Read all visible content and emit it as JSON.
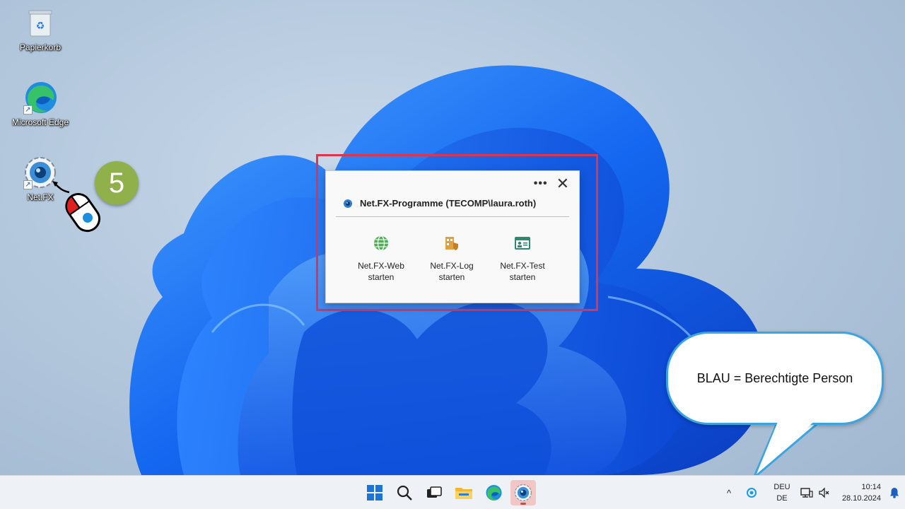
{
  "desktop": {
    "icons": [
      {
        "label": "Papierkorb"
      },
      {
        "label": "Microsoft Edge"
      },
      {
        "label": "Net.FX"
      }
    ],
    "step_number": "5"
  },
  "popup": {
    "title": "Net.FX-Programme (TECOMP\\laura.roth)",
    "more_label": "•••",
    "close_label": "✕",
    "actions": [
      {
        "line1": "Net.FX-Web",
        "line2": "starten",
        "icon": "globe-icon",
        "color": "#4caf50"
      },
      {
        "line1": "Net.FX-Log",
        "line2": "starten",
        "icon": "building-shield-icon",
        "color": "#e0a040"
      },
      {
        "line1": "Net.FX-Test",
        "line2": "starten",
        "icon": "id-card-icon",
        "color": "#2e8a6e"
      }
    ],
    "highlight_color": "#e0344a"
  },
  "callout": {
    "text": "BLAU = Berechtigte Person",
    "border_color": "#3aa5e0"
  },
  "taskbar": {
    "apps": [
      "start-icon",
      "search-icon",
      "task-view-icon",
      "file-explorer-icon",
      "edge-icon",
      "netfx-icon"
    ],
    "tray": {
      "chevron": "^",
      "lang_line1": "DEU",
      "lang_line2": "DE",
      "time": "10:14",
      "date": "28.10.2024"
    }
  }
}
